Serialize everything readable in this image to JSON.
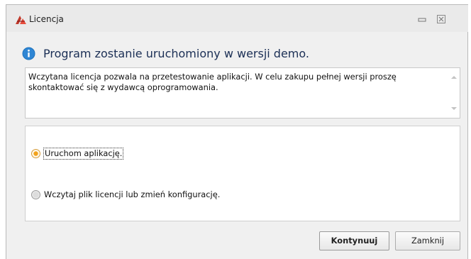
{
  "window": {
    "title": "Licencja",
    "minimize_glyph": "▭",
    "close_glyph": "☒"
  },
  "header": {
    "icon": "info-icon",
    "text": "Program zostanie uruchomiony w wersji demo."
  },
  "message": {
    "text": "Wczytana licencja pozwala na przetestowanie aplikacji. W celu zakupu pełnej wersji proszę skontaktować się z wydawcą oprogramowania."
  },
  "options": [
    {
      "label": "Uruchom aplikację.",
      "selected": true
    },
    {
      "label": "Wczytaj plik licencji lub zmień konfigurację.",
      "selected": false
    }
  ],
  "buttons": {
    "continue_label": "Kontynuuj",
    "close_label": "Zamknij"
  },
  "colors": {
    "header_text": "#1b2f55",
    "info_icon": "#1e73be",
    "radio_selected": "#f2a21b"
  }
}
